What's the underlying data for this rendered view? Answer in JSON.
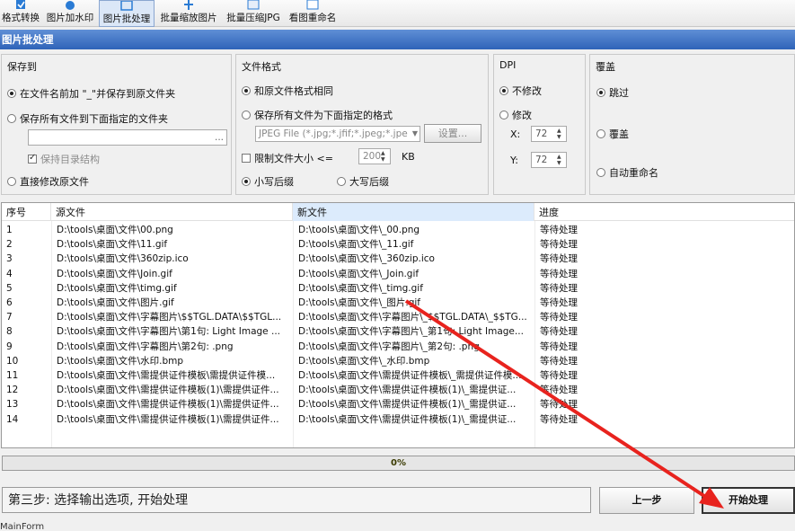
{
  "toolbar": {
    "items": [
      {
        "label": "格式转换",
        "icon": "format-convert-icon"
      },
      {
        "label": "图片加水印",
        "icon": "watermark-icon"
      },
      {
        "label": "图片批处理",
        "icon": "batch-process-icon",
        "active": true
      },
      {
        "label": "批量缩放图片",
        "icon": "resize-icon"
      },
      {
        "label": "批量压缩JPG",
        "icon": "compress-jpg-icon"
      },
      {
        "label": "看图重命名",
        "icon": "rename-icon"
      }
    ]
  },
  "title": "图片批处理",
  "save_to": {
    "title": "保存到",
    "option_prefix": "在文件名前加 \"_\"并保存到原文件夹",
    "option_folder": "保存所有文件到下面指定的文件夹",
    "folder_browse": "...",
    "keep_structure": "保持目录结构",
    "option_overwrite": "直接修改原文件"
  },
  "file_format": {
    "title": "文件格式",
    "option_same": "和原文件格式相同",
    "option_specified": "保存所有文件为下面指定的格式",
    "format_select": "JPEG File (*.jpg;*.jfif;*.jpeg;*.jpe",
    "settings_button": "设置...",
    "limit_size_label": "限制文件大小  <=",
    "limit_size_value": "200",
    "limit_size_unit": "KB",
    "option_lowercase": "小写后缀",
    "option_uppercase": "大写后缀"
  },
  "dpi": {
    "title": "DPI",
    "option_keep": "不修改",
    "option_modify": "修改",
    "x_label": "X:",
    "x_value": "72",
    "y_label": "Y:",
    "y_value": "72"
  },
  "overwrite": {
    "title": "覆盖",
    "option_skip": "跳过",
    "option_overwrite": "覆盖",
    "option_auto_rename": "自动重命名"
  },
  "table": {
    "headers": [
      "序号",
      "源文件",
      "新文件",
      "进度"
    ],
    "rows": [
      [
        "1",
        "D:\\tools\\桌面\\文件\\00.png",
        "D:\\tools\\桌面\\文件\\_00.png",
        "等待处理"
      ],
      [
        "2",
        "D:\\tools\\桌面\\文件\\11.gif",
        "D:\\tools\\桌面\\文件\\_11.gif",
        "等待处理"
      ],
      [
        "3",
        "D:\\tools\\桌面\\文件\\360zip.ico",
        "D:\\tools\\桌面\\文件\\_360zip.ico",
        "等待处理"
      ],
      [
        "4",
        "D:\\tools\\桌面\\文件\\Join.gif",
        "D:\\tools\\桌面\\文件\\_Join.gif",
        "等待处理"
      ],
      [
        "5",
        "D:\\tools\\桌面\\文件\\timg.gif",
        "D:\\tools\\桌面\\文件\\_timg.gif",
        "等待处理"
      ],
      [
        "6",
        "D:\\tools\\桌面\\文件\\图片.gif",
        "D:\\tools\\桌面\\文件\\_图片.gif",
        "等待处理"
      ],
      [
        "7",
        "D:\\tools\\桌面\\文件\\字幕图片\\$$TGL.DATA\\$$TGL...",
        "D:\\tools\\桌面\\文件\\字幕图片\\_$$TGL.DATA\\_$$TG...",
        "等待处理"
      ],
      [
        "8",
        "D:\\tools\\桌面\\文件\\字幕图片\\第1句: Light Image ...",
        "D:\\tools\\桌面\\文件\\字幕图片\\_第1句: Light Image...",
        "等待处理"
      ],
      [
        "9",
        "D:\\tools\\桌面\\文件\\字幕图片\\第2句: .png",
        "D:\\tools\\桌面\\文件\\字幕图片\\_第2句: .png",
        "等待处理"
      ],
      [
        "10",
        "D:\\tools\\桌面\\文件\\水印.bmp",
        "D:\\tools\\桌面\\文件\\_水印.bmp",
        "等待处理"
      ],
      [
        "11",
        "D:\\tools\\桌面\\文件\\需提供证件模板\\需提供证件模...",
        "D:\\tools\\桌面\\文件\\需提供证件模板\\_需提供证件模...",
        "等待处理"
      ],
      [
        "12",
        "D:\\tools\\桌面\\文件\\需提供证件模板(1)\\需提供证件...",
        "D:\\tools\\桌面\\文件\\需提供证件模板(1)\\_需提供证...",
        "等待处理"
      ],
      [
        "13",
        "D:\\tools\\桌面\\文件\\需提供证件模板(1)\\需提供证件...",
        "D:\\tools\\桌面\\文件\\需提供证件模板(1)\\_需提供证...",
        "等待处理"
      ],
      [
        "14",
        "D:\\tools\\桌面\\文件\\需提供证件模板(1)\\需提供证件...",
        "D:\\tools\\桌面\\文件\\需提供证件模板(1)\\_需提供证...",
        "等待处理"
      ]
    ]
  },
  "progress": {
    "percent": 0,
    "label": "0%"
  },
  "status_text": "第三步: 选择输出选项, 开始处理",
  "prev_button": "上一步",
  "start_button": "开始处理",
  "footer_text": "MainForm",
  "colors": {
    "arrow": "#e8231e",
    "title_bar": "#3a6fc4"
  }
}
